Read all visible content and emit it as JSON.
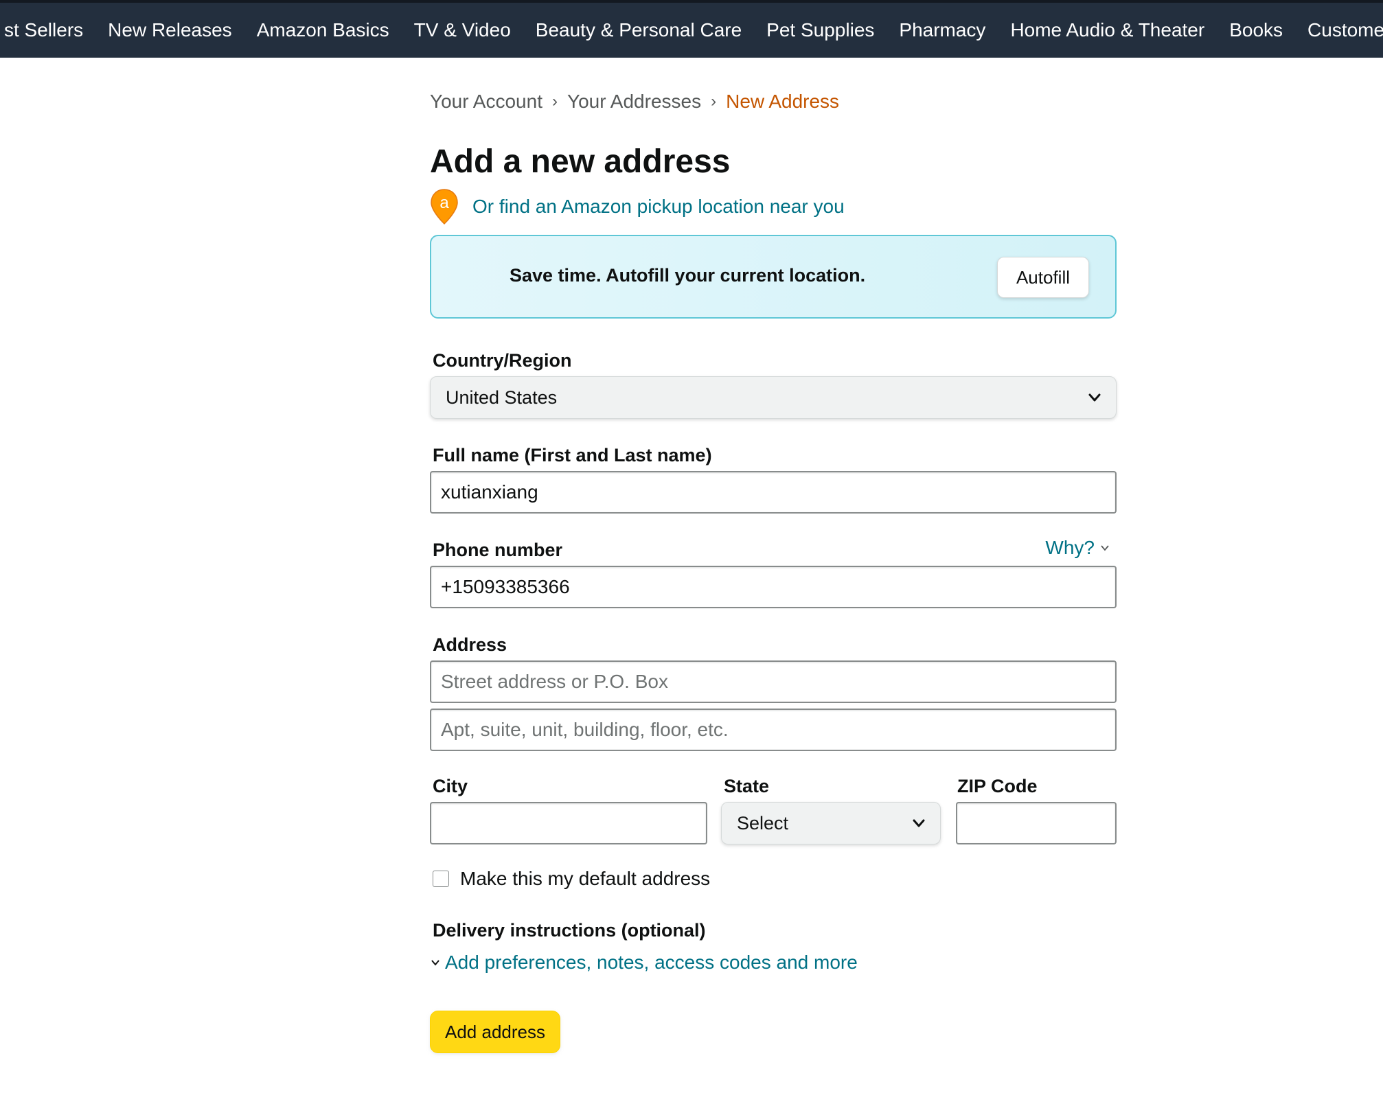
{
  "nav": {
    "items": [
      "st Sellers",
      "New Releases",
      "Amazon Basics",
      "TV & Video",
      "Beauty & Personal Care",
      "Pet Supplies",
      "Pharmacy",
      "Home Audio & Theater",
      "Books",
      "Customer S"
    ]
  },
  "breadcrumb": {
    "account": "Your Account",
    "addresses": "Your Addresses",
    "current": "New Address",
    "separator": "›"
  },
  "page_title": "Add a new address",
  "pickup": {
    "icon": "amazon-pickup-pin-icon",
    "icon_letter": "a",
    "link": "Or find an Amazon pickup location near you"
  },
  "autofill": {
    "text": "Save time. Autofill your current location.",
    "button": "Autofill"
  },
  "form": {
    "country_label": "Country/Region",
    "country_value": "United States",
    "fullname_label": "Full name (First and Last name)",
    "fullname_value": "xutianxiang",
    "phone_label": "Phone number",
    "phone_why": "Why?",
    "phone_value": "+15093385366",
    "address_label": "Address",
    "address_line1_placeholder": "Street address or P.O. Box",
    "address_line2_placeholder": "Apt, suite, unit, building, floor, etc.",
    "city_label": "City",
    "city_value": "",
    "state_label": "State",
    "state_value": "Select",
    "zip_label": "ZIP Code",
    "zip_value": "",
    "default_checkbox_label": "Make this my default address",
    "default_checked": false,
    "delivery_label": "Delivery instructions (optional)",
    "delivery_link": "Add preferences, notes, access codes and more",
    "submit": "Add address"
  },
  "colors": {
    "nav_bg": "#232f3e",
    "link": "#007185",
    "breadcrumb_current": "#c45500",
    "autofill_border": "#5fc7d6",
    "primary_button": "#ffd814",
    "pickup_pin": "#ff9900"
  }
}
